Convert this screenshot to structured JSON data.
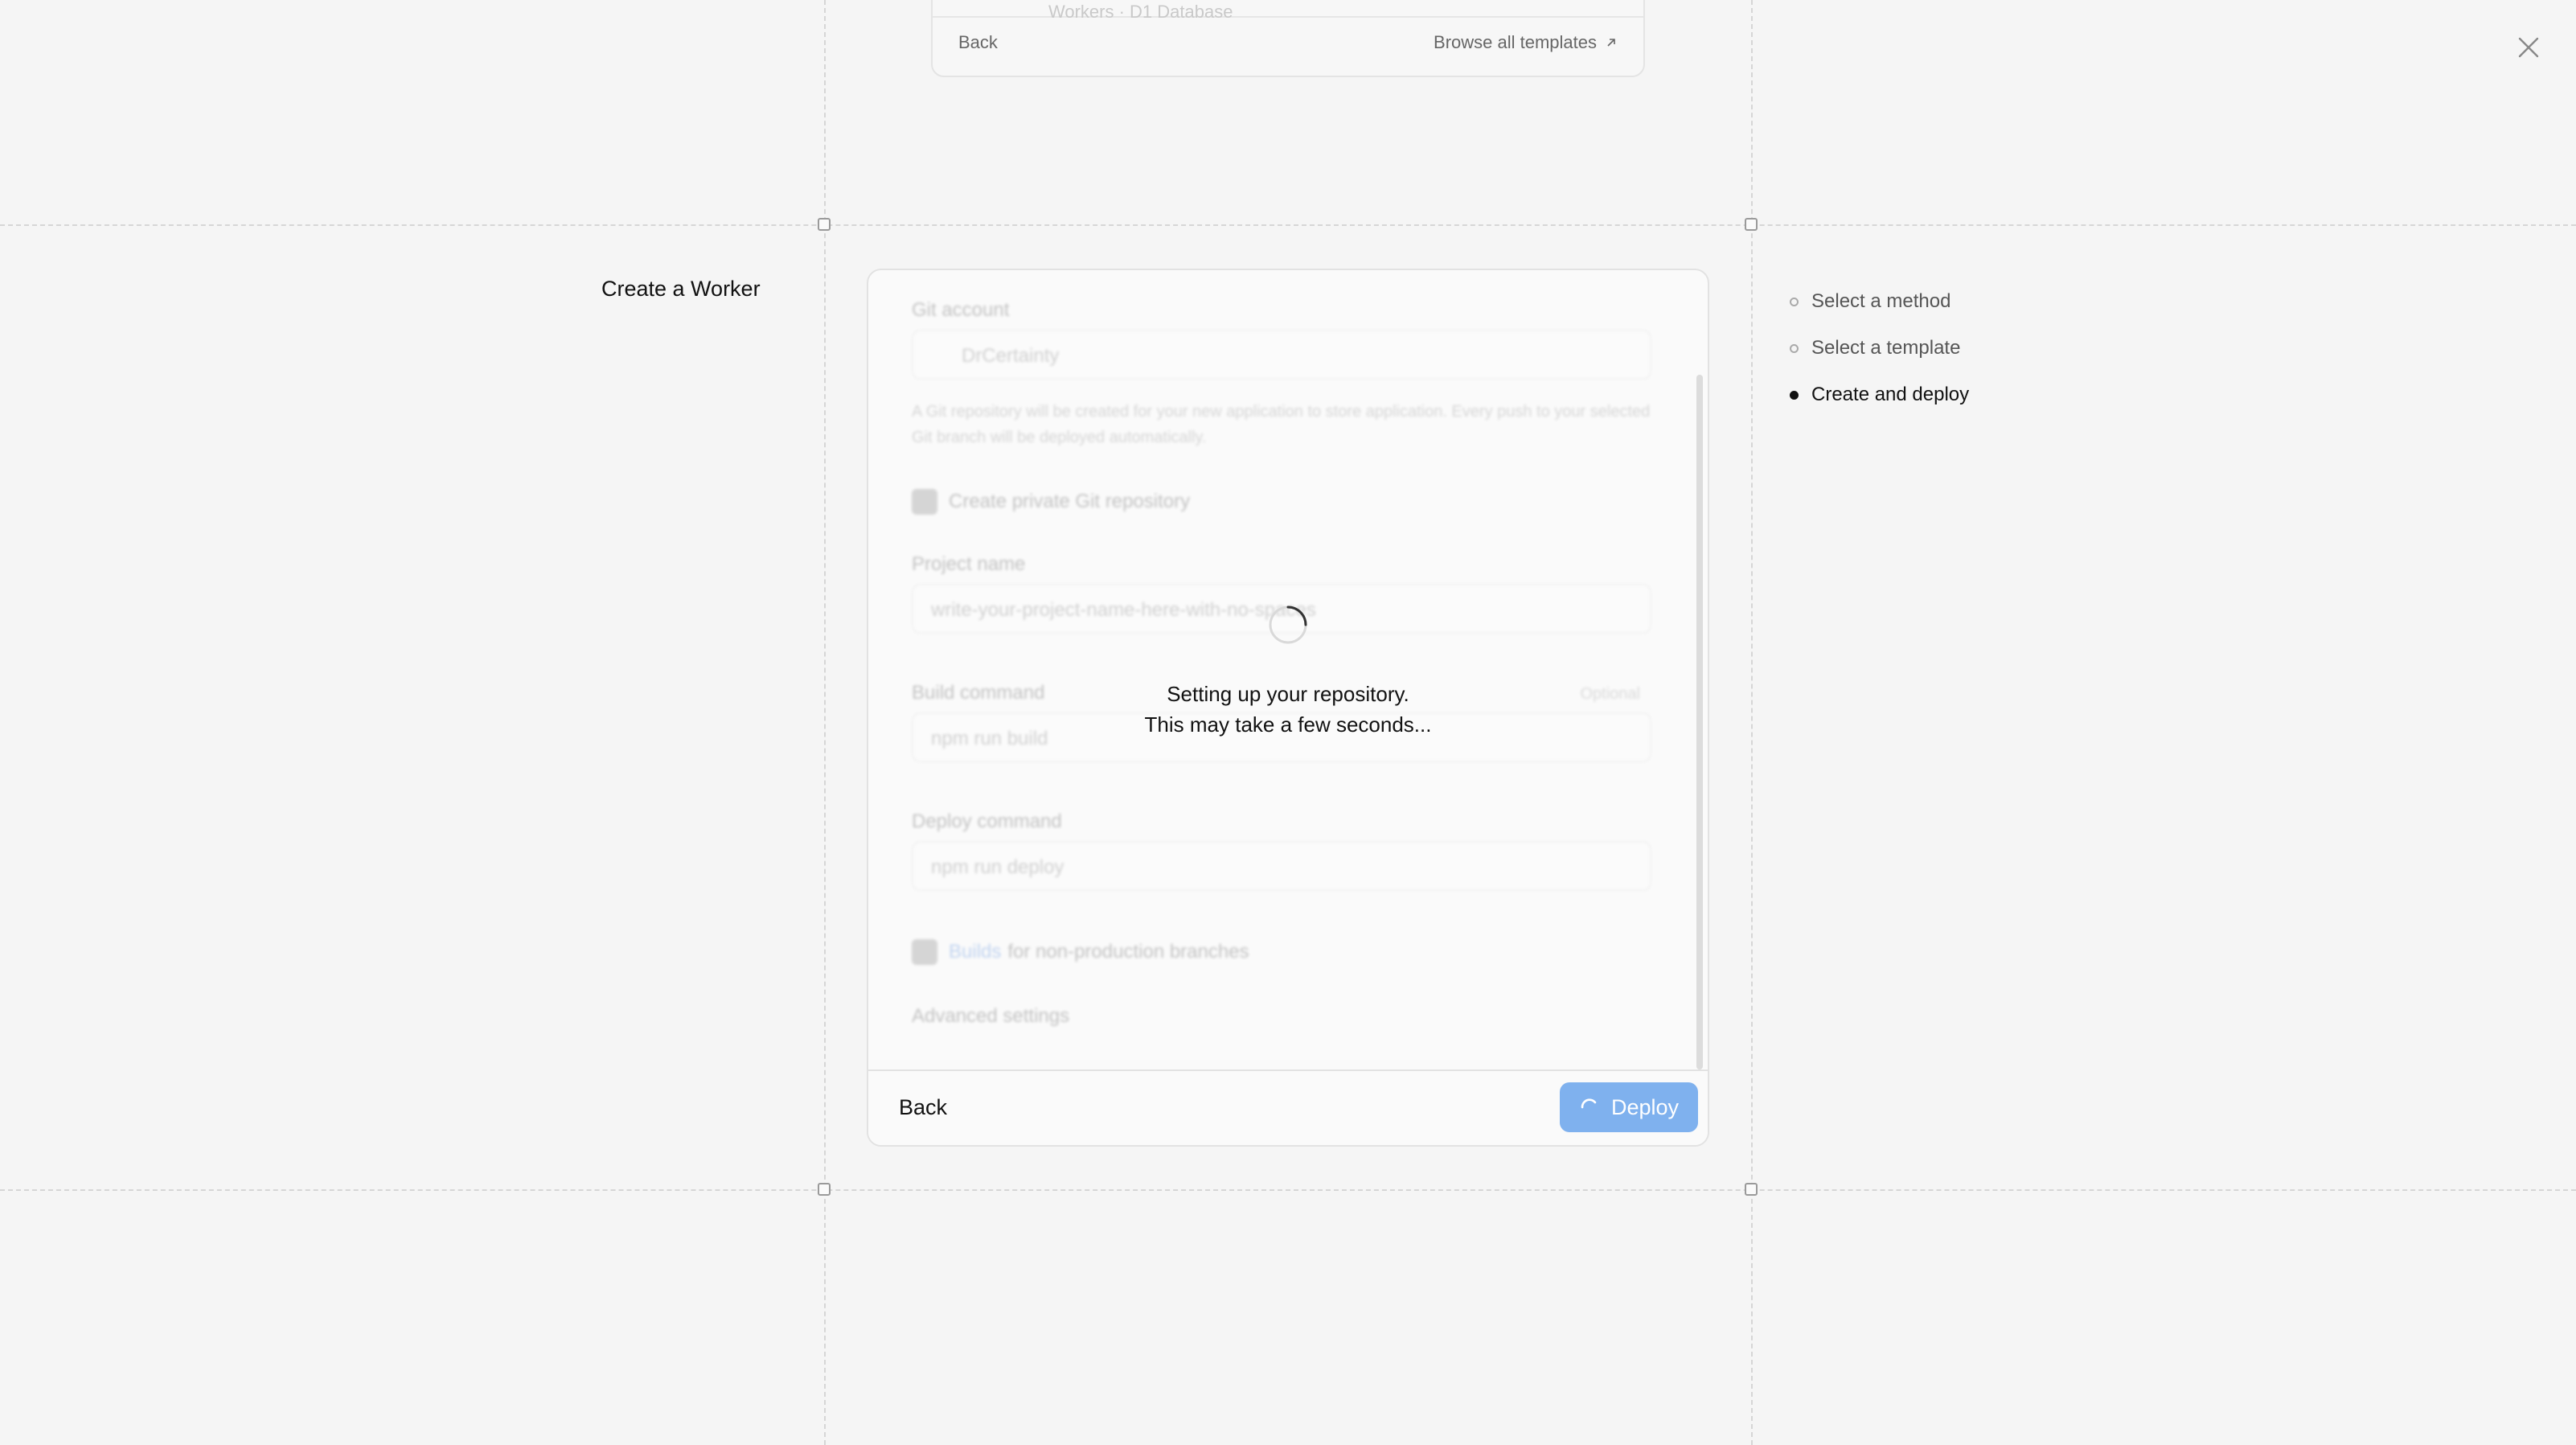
{
  "previous_card": {
    "inner_text": "Workers · D1 Database",
    "back_label": "Back",
    "browse_label": "Browse all templates"
  },
  "page_title": "Create a Worker",
  "steps": [
    {
      "label": "Select a method",
      "active": false
    },
    {
      "label": "Select a template",
      "active": false
    },
    {
      "label": "Create and deploy",
      "active": true
    }
  ],
  "form": {
    "git_account_label": "Git account",
    "git_account_value": "DrCertainty",
    "git_help": "A Git repository will be created for your new application to store application. Every push to your selected Git branch will be deployed automatically.",
    "private_repo_label": "Create private Git repository",
    "project_name_label": "Project name",
    "project_name_value": "write-your-project-name-here-with-no-spaces",
    "build_command_label": "Build command",
    "build_optional": "Optional",
    "build_command_value": "npm run build",
    "deploy_command_label": "Deploy command",
    "deploy_command_value": "npm run deploy",
    "builds_link": "Builds",
    "builds_suffix": "for non-production branches",
    "advanced_settings": "Advanced settings"
  },
  "loading": {
    "line1": "Setting up your repository.",
    "line2": "This may take a few seconds..."
  },
  "footer": {
    "back_label": "Back",
    "deploy_label": "Deploy"
  },
  "colors": {
    "deploy_button": "#7fb1ee",
    "background": "#f5f5f5"
  }
}
